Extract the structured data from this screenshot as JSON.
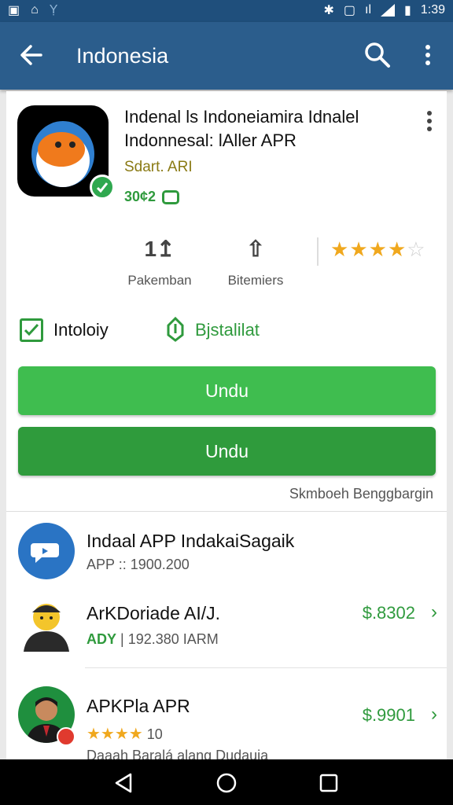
{
  "status_bar": {
    "time": "1:39"
  },
  "app_bar": {
    "title": "Indonesia"
  },
  "app": {
    "title": "Indenal ls Indoneiamira Idnalel Indonnesal: lAller APR",
    "developer": "Sdart. ARI",
    "size": "30¢2",
    "stats": [
      {
        "icon": "1↥",
        "label": "Pakemban"
      },
      {
        "icon": "⇧",
        "label": "Bitemiers"
      }
    ],
    "rating": 4,
    "check_label": "Intoloiy",
    "install_label": "Bjstalilat",
    "button1": "Undu",
    "button2": "Undu",
    "footnote": "Skmboeh Benggbargin"
  },
  "list": [
    {
      "title": "Indaal APP IndakaiSagaik",
      "sub": "APP :: 1900.200"
    },
    {
      "title": "ArKDoriade AI/J.",
      "sub_green": "ADY",
      "sub": " | 192.380 IARM",
      "price": "$.8302"
    },
    {
      "title": "APKPla APR",
      "stars": "★★★★",
      "sub": " 10",
      "price": "$.9901"
    }
  ],
  "list_cutoff_text": "Daaah Baralá alang Dudauia",
  "colors": {
    "primary": "#2b5d8c",
    "accent_green": "#2f9a3d",
    "star": "#f0a81e"
  }
}
